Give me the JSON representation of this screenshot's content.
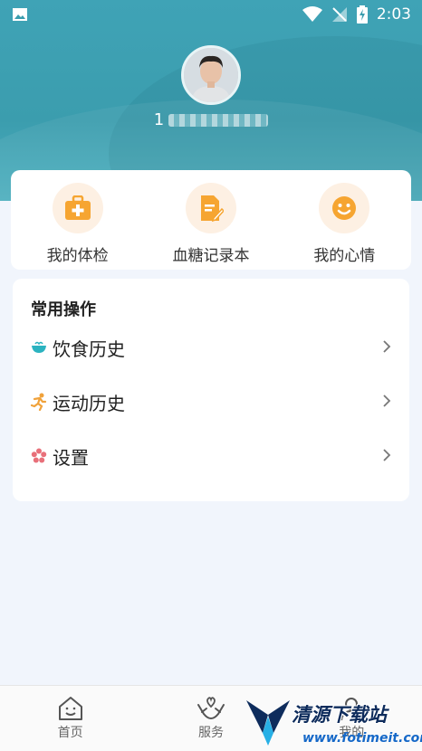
{
  "status_bar": {
    "time": "2:03",
    "icons": [
      "image-icon",
      "wifi-icon",
      "no-signal-icon",
      "battery-charging-icon"
    ]
  },
  "profile": {
    "avatar_icon": "user-avatar",
    "phone_prefix": "1"
  },
  "quick_actions": [
    {
      "label": "我的体检",
      "icon": "medical-kit-icon"
    },
    {
      "label": "血糖记录本",
      "icon": "notebook-icon"
    },
    {
      "label": "我的心情",
      "icon": "smile-icon"
    }
  ],
  "common_ops": {
    "title": "常用操作",
    "items": [
      {
        "label": "饮食历史",
        "icon": "bowl-icon",
        "icon_color": "#2bb3c0"
      },
      {
        "label": "运动历史",
        "icon": "running-icon",
        "icon_color": "#f0a23b"
      },
      {
        "label": "设置",
        "icon": "flower-gear-icon",
        "icon_color": "#e8707a"
      }
    ]
  },
  "bottom_nav": [
    {
      "label": "首页",
      "icon": "home-icon"
    },
    {
      "label": "服务",
      "icon": "hands-heart-icon"
    },
    {
      "label": "我的",
      "icon": "user-icon"
    }
  ],
  "watermark": {
    "text": "清源下载站",
    "url": "www.fotimeit.com"
  },
  "colors": {
    "header": "#3b9dae",
    "quick_icon_bg": "#fdf0e3",
    "quick_icon": "#f6a531",
    "background": "#f1f5fc"
  }
}
